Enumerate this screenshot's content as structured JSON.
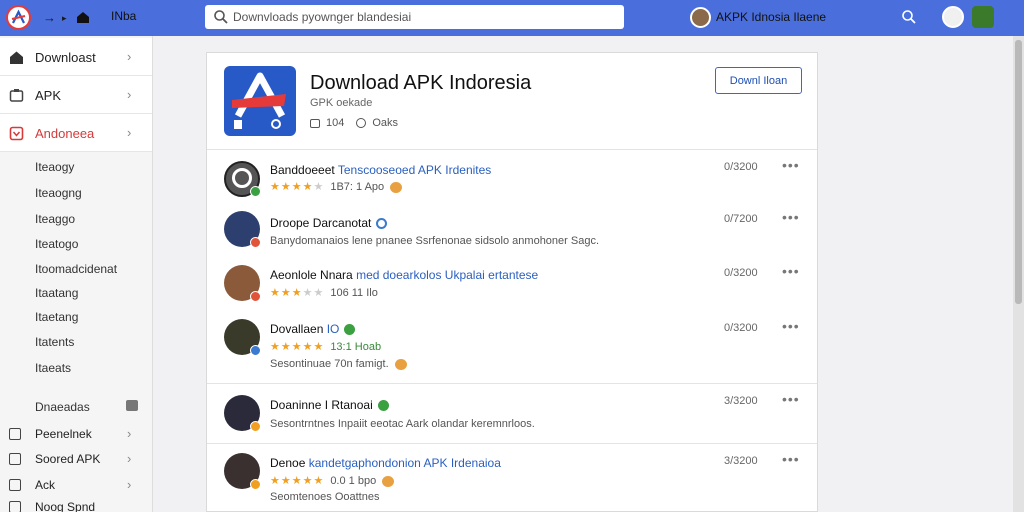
{
  "topbar": {
    "title": "INba",
    "search_placeholder": "Downvloads pyownger blandesiai",
    "account_name": "AKPK Idnosia Ilaene"
  },
  "sidebar": {
    "main_items": [
      {
        "label": "Downloast",
        "icon": "home-icon"
      },
      {
        "label": "APK",
        "icon": "apk-icon"
      },
      {
        "label": "Andoneea",
        "icon": "indonesia-icon",
        "active": true
      }
    ],
    "sub_items": [
      "Iteaogy",
      "Iteaogng",
      "Iteaggo",
      "Iteatogo",
      "Itoomadcidenat",
      "Itaatang",
      "Itaetang",
      "Itatents",
      "Itaeats"
    ],
    "section_label": "Dnaeadas",
    "bottom_items": [
      {
        "label": "Peenelnek"
      },
      {
        "label": "Soored APK"
      },
      {
        "label": "Ack"
      },
      {
        "label": "Noog Spnd"
      }
    ]
  },
  "app": {
    "title": "Download APK Indoresia",
    "subtitle": "GPK oekade",
    "meta_count": "104",
    "meta_label": "Oaks",
    "download_label": "Downl Iloan"
  },
  "reviews": [
    {
      "name": "Banddoeeet",
      "name_accent": "Tenscooseoed APK Irdenites",
      "stars": 4,
      "line2": "1B7: 1 Apo",
      "date": "0/3200",
      "emoji": true
    },
    {
      "name": "Droope Darcanotat",
      "line2": "Banydomanaios lene pnanee Ssrfenonae sidsolo anmohoner Sagc.",
      "date": "0/7200",
      "verify": "#3a7ad0"
    },
    {
      "name": "Aeonlole Nnara",
      "name_accent": "med doearkolos Ukpalai ertantese",
      "stars": 3,
      "line2": "106 11 Ilo",
      "date": "0/3200"
    },
    {
      "name": "Dovallaen",
      "name_accent": "IO",
      "verify": "#3aa040",
      "stars": 5,
      "line2": "13:1 Hoab",
      "line3": "Sesontinuae 70n famigt.",
      "date": "0/3200",
      "emoji": true
    },
    {
      "name": "Doaninne I Rtanoai",
      "verify": "#3aa040",
      "line2": "Sesontrntnes Inpaiit eeotac Aark olandar keremnrloos.",
      "date": "3/3200"
    },
    {
      "name": "Denoe",
      "name_accent": "kandetgaphondonion APK Irdenaioa",
      "stars": 5,
      "line2": "0.0 1 bpo",
      "line3": "Seomtenoes Ooattnes",
      "date": "3/3200",
      "emoji": true
    }
  ],
  "colors": {
    "topbar": "#4a6fdc",
    "accent_red": "#d63a3a",
    "link_blue": "#2a5fc0",
    "star": "#f0a020"
  }
}
